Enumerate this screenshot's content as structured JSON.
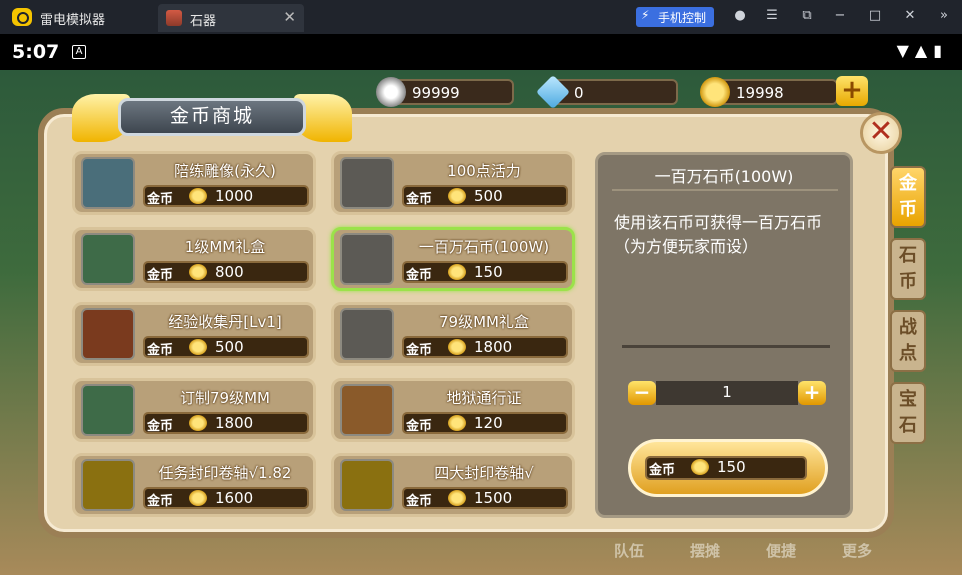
{
  "titlebar": {
    "app_name": "雷电模拟器",
    "tab_label": "石器",
    "tab_close": "✕",
    "phone_control": "手机控制",
    "icons": [
      "user-icon",
      "menu-icon",
      "popout-icon",
      "minimize-icon",
      "maximize-icon",
      "close-icon",
      "sidebar-expand-icon"
    ]
  },
  "statusbar": {
    "time": "5:07",
    "notif_icon": "A"
  },
  "currency": {
    "stone": "99999",
    "crystal": "0",
    "gold": "19998",
    "add": "+"
  },
  "shop": {
    "title": "金币商城",
    "close": "✕",
    "items": [
      {
        "name": "陪练雕像(永久)",
        "currency": "金币",
        "price": "1000"
      },
      {
        "name": "100点活力",
        "currency": "金币",
        "price": "500"
      },
      {
        "name": "1级MM礼盒",
        "currency": "金币",
        "price": "800"
      },
      {
        "name": "一百万石币(100W)",
        "currency": "金币",
        "price": "150"
      },
      {
        "name": "经验收集丹[Lv1]",
        "currency": "金币",
        "price": "500"
      },
      {
        "name": "79级MM礼盒",
        "currency": "金币",
        "price": "1800"
      },
      {
        "name": "订制79级MM",
        "currency": "金币",
        "price": "1800"
      },
      {
        "name": "地狱通行证",
        "currency": "金币",
        "price": "120"
      },
      {
        "name": "任务封印卷轴√1.82",
        "currency": "金币",
        "price": "1600"
      },
      {
        "name": "四大封印卷轴√",
        "currency": "金币",
        "price": "1500"
      }
    ]
  },
  "detail": {
    "title": "一百万石币(100W)",
    "description": "使用该石币可获得一百万石币 （为方便玩家而设）",
    "quantity": "1",
    "minus": "−",
    "plus": "+",
    "buy_currency": "金币",
    "buy_price": "150"
  },
  "side_tabs": [
    {
      "label": "金\n币",
      "active": true
    },
    {
      "label": "石\n币",
      "active": false
    },
    {
      "label": "战\n点",
      "active": false
    },
    {
      "label": "宝\n石",
      "active": false
    }
  ],
  "bottom_menu": [
    "队伍",
    "摆摊",
    "便捷",
    "更多"
  ]
}
